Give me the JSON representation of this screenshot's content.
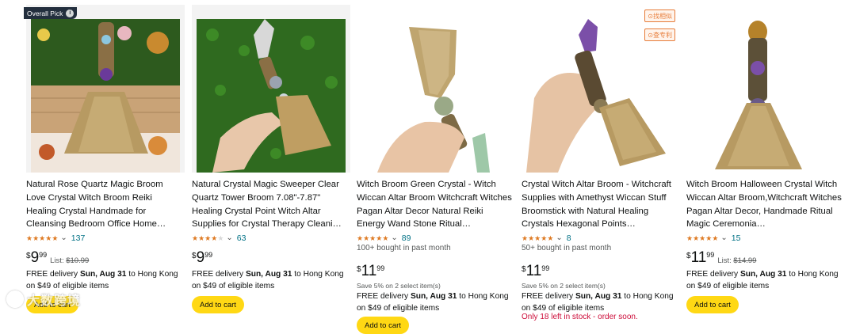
{
  "badge": {
    "label": "Overall Pick",
    "info": "i"
  },
  "tags": {
    "find_similar": "⊙找相似",
    "check_patent": "⊙查专利"
  },
  "watermark": {
    "text": "大数跨境"
  },
  "colors": {
    "star": "#de7921",
    "link": "#007185",
    "button": "#ffd814",
    "badge_bg": "#232f3e",
    "stock_warn": "#cc0c39",
    "tag": "#e77c39"
  },
  "products": [
    {
      "title": "Natural Rose Quartz Magic Broom Love Crystal Witch Broom Reiki Healing Crystal Handmade for Cleansing Bedroom Office Home…",
      "rating": 4.5,
      "reviews": "137",
      "bought": "",
      "price_currency": "$",
      "price_whole": "9",
      "price_fraction": "99",
      "list_label": "List:",
      "list_price": "$10.99",
      "save": "",
      "delivery_prefix": "FREE delivery ",
      "delivery_date": "Sun, Aug 31",
      "delivery_dest": " to Hong Kong",
      "delivery_min": "on $49 of eligible items",
      "cart": "Add to cart",
      "stock": ""
    },
    {
      "title": "Natural Crystal Magic Sweeper Clear Quartz Tower Broom 7.08\"-7.87\" Healing Crystal Point Witch Altar Supplies for Crystal Therapy Cleani…",
      "rating": 4.0,
      "reviews": "63",
      "bought": "",
      "price_currency": "$",
      "price_whole": "9",
      "price_fraction": "99",
      "list_label": "",
      "list_price": "",
      "save": "",
      "delivery_prefix": "FREE delivery ",
      "delivery_date": "Sun, Aug 31",
      "delivery_dest": " to Hong Kong",
      "delivery_min": "on $49 of eligible items",
      "cart": "Add to cart",
      "stock": ""
    },
    {
      "title": "Witch Broom Green Crystal - Witch Wiccan Altar Broom Witchcraft Witches Pagan Altar Decor Natural Reiki Energy Wand Stone Ritual…",
      "rating": 4.5,
      "reviews": "89",
      "bought": "100+ bought in past month",
      "price_currency": "$",
      "price_whole": "11",
      "price_fraction": "99",
      "list_label": "",
      "list_price": "",
      "save": "Save 5% on 2 select item(s)",
      "delivery_prefix": "FREE delivery ",
      "delivery_date": "Sun, Aug 31",
      "delivery_dest": " to Hong Kong",
      "delivery_min": "on $49 of eligible items",
      "cart": "Add to cart",
      "stock": ""
    },
    {
      "title": "Crystal Witch Altar Broom - Witchcraft Supplies with Amethyst Wiccan Stuff Broomstick with Natural Healing Crystals Hexagonal Points…",
      "rating": 5.0,
      "reviews": "8",
      "bought": "50+ bought in past month",
      "price_currency": "$",
      "price_whole": "11",
      "price_fraction": "99",
      "list_label": "",
      "list_price": "",
      "save": "Save 5% on 2 select item(s)",
      "delivery_prefix": "FREE delivery ",
      "delivery_date": "Sun, Aug 31",
      "delivery_dest": " to Hong Kong",
      "delivery_min": "on $49 of eligible items",
      "cart": "",
      "stock": "Only 18 left in stock - order soon."
    },
    {
      "title": "Witch Broom Halloween Crystal Witch Wiccan Altar Broom,Witchcraft Witches Pagan Altar Decor, Handmade Ritual Magic Ceremonia…",
      "rating": 4.5,
      "reviews": "15",
      "bought": "",
      "price_currency": "$",
      "price_whole": "11",
      "price_fraction": "99",
      "list_label": "List:",
      "list_price": "$14.99",
      "save": "",
      "delivery_prefix": "FREE delivery ",
      "delivery_date": "Sun, Aug 31",
      "delivery_dest": " to Hong Kong",
      "delivery_min": "on $49 of eligible items",
      "cart": "Add to cart",
      "stock": ""
    }
  ]
}
